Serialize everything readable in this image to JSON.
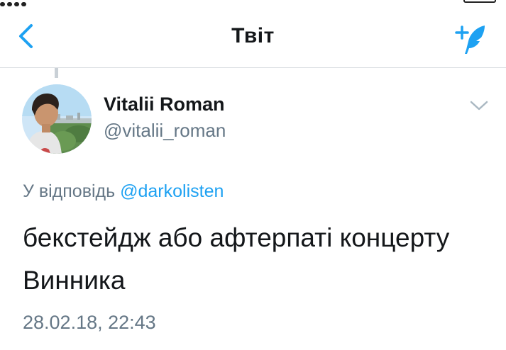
{
  "navbar": {
    "title": "Твіт",
    "back_icon": "chevron-left-icon",
    "compose_icon": "compose-tweet-icon",
    "accent_color": "#1da1f2"
  },
  "tweet": {
    "display_name": "Vitalii Roman",
    "username": "@vitalii_roman",
    "menu_icon": "chevron-down-icon",
    "reply_prefix": "У відповідь",
    "reply_to": "@darkolisten",
    "text": "бекстейдж або афтерпаті концерту Винника",
    "timestamp": "28.02.18, 22:43"
  },
  "colors": {
    "text_primary": "#14171a",
    "text_secondary": "#657786",
    "link": "#1da1f2",
    "divider": "#d9dde1"
  }
}
